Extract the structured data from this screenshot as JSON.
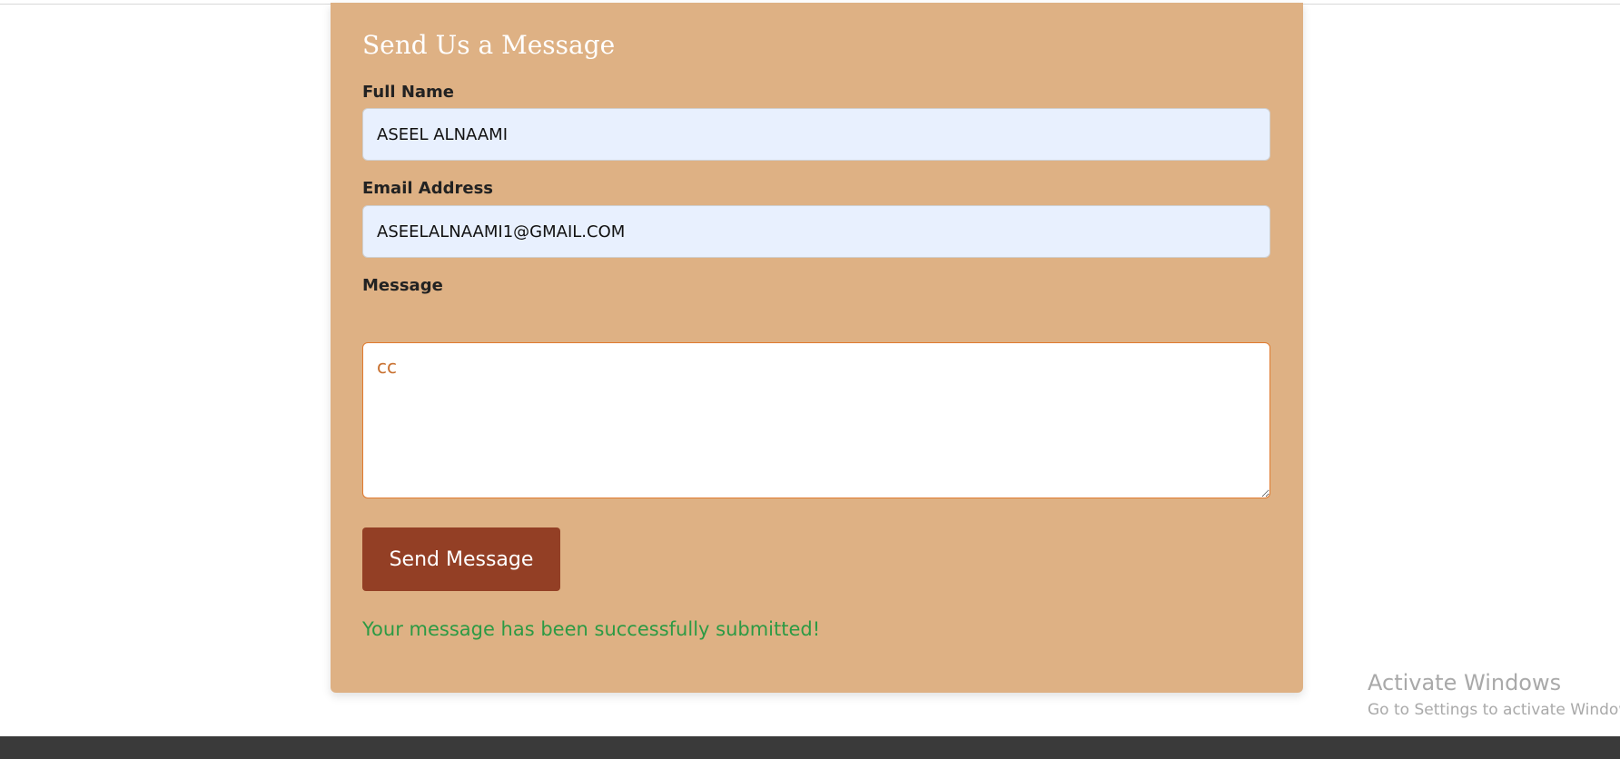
{
  "form": {
    "title": "Send Us a Message",
    "full_name": {
      "label": "Full Name",
      "value": "ASEEL ALNAAMI"
    },
    "email": {
      "label": "Email Address",
      "value": "ASEELALNAAMI1@GMAIL.COM"
    },
    "message": {
      "label": "Message",
      "value": "cc"
    },
    "submit_label": "Send Message",
    "success_message": "Your message has been successfully submitted!"
  },
  "watermark": {
    "title": "Activate Windows",
    "subtitle": "Go to Settings to activate Windows."
  },
  "colors": {
    "card_background": "#deb184",
    "button_background": "#933f25",
    "success_text": "#2c9a44",
    "autofill_input": "#e8f0fe",
    "focus_border": "#e07a2f",
    "footer": "#3a3a3a"
  }
}
